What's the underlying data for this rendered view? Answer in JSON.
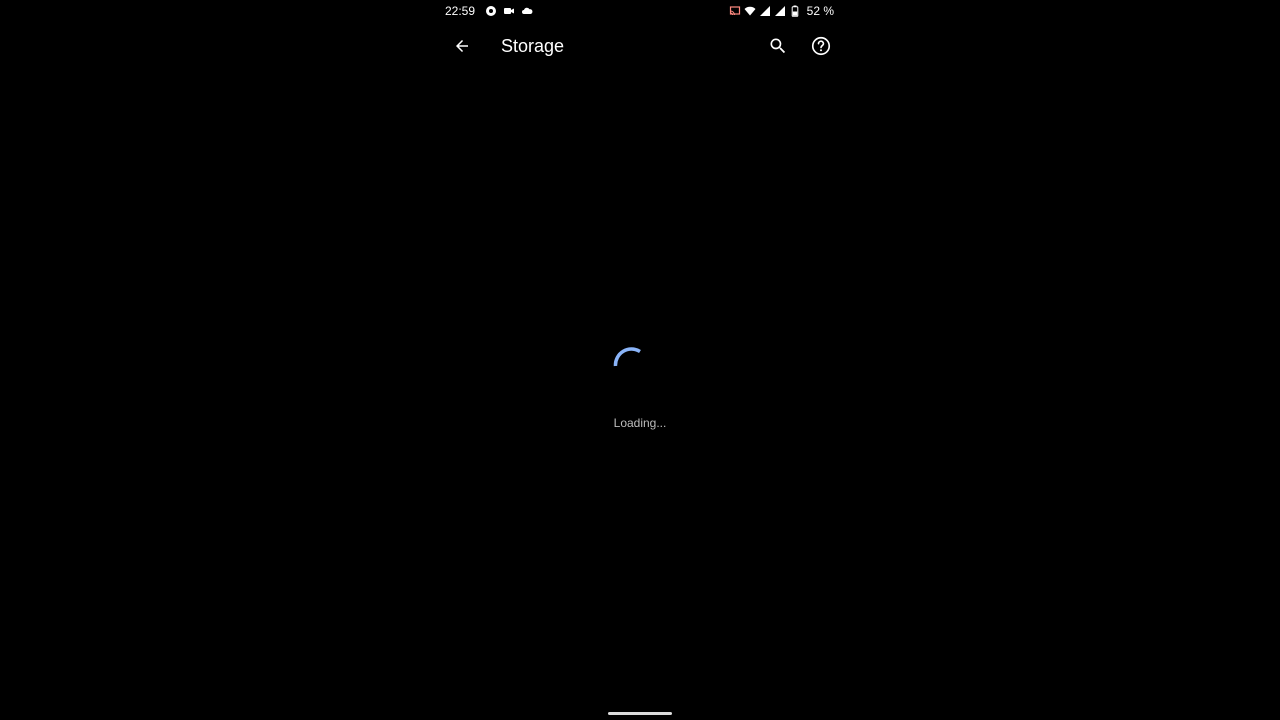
{
  "status_bar": {
    "time": "22:59",
    "battery_percent": "52 %",
    "left_icons": [
      "record-icon",
      "video-camera-icon",
      "cloud-icon"
    ],
    "right_icons": [
      "cast-icon",
      "wifi-icon",
      "signal-icon",
      "signal-icon",
      "battery-icon"
    ]
  },
  "app_bar": {
    "title": "Storage",
    "back_icon": "arrow-back-icon",
    "search_icon": "search-icon",
    "help_icon": "help-circle-icon"
  },
  "content": {
    "loading_text": "Loading...",
    "spinner_color": "#8ab4f8"
  },
  "colors": {
    "background": "#000000",
    "text_primary": "#ffffff",
    "text_secondary": "#bdbdbd",
    "accent": "#8ab4f8"
  }
}
